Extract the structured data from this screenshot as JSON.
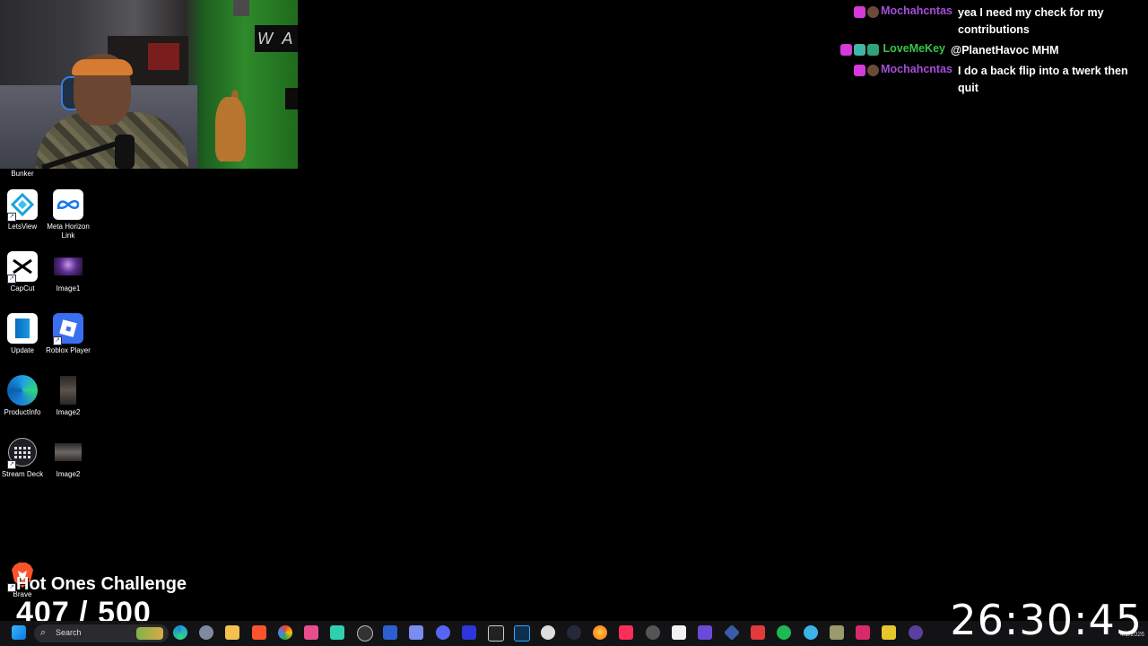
{
  "desktop": {
    "top_label": "Bunker",
    "icons": [
      {
        "label": "LetsView",
        "icon": "letsview-icon",
        "color": "#ffffff"
      },
      {
        "label": "Meta Horizon Link",
        "icon": "meta-icon",
        "color": "#ffffff"
      },
      {
        "label": "CapCut",
        "icon": "capcut-icon",
        "color": "#ffffff"
      },
      {
        "label": "Image1",
        "icon": "image-thumbnail-icon",
        "color": "#5b2d8f"
      },
      {
        "label": "Update",
        "icon": "update-icon",
        "color": "#ffffff"
      },
      {
        "label": "Roblox Player",
        "icon": "roblox-icon",
        "color": "#3b6ff2"
      },
      {
        "label": "ProductInfo",
        "icon": "edge-icon",
        "color": "#1b86d8"
      },
      {
        "label": "Image2",
        "icon": "image-thumbnail-icon",
        "color": "#3a3532"
      },
      {
        "label": "Stream Deck",
        "icon": "stream-deck-icon",
        "color": "#1e1e26"
      },
      {
        "label": "Image2",
        "icon": "image-thumbnail-icon",
        "color": "#4b4a48"
      },
      {
        "label": "Brave",
        "icon": "brave-icon",
        "color": "#fb542b"
      }
    ]
  },
  "chat": {
    "messages": [
      {
        "user": "Mochahcntas",
        "color": "#a64dd8",
        "text": "yea I need my check for my contributions",
        "badges": [
          "sub-badge-icon",
          "avatar-badge-icon"
        ]
      },
      {
        "user": "LoveMeKey",
        "color": "#35c64a",
        "text": "@PlanetHavoc MHM",
        "badges": [
          "sub-badge-icon",
          "gift-badge-icon",
          "gift-badge-icon"
        ]
      },
      {
        "user": "Mochahcntas",
        "color": "#a64dd8",
        "text": "I do a back flip into a twerk then quit",
        "badges": [
          "sub-badge-icon",
          "avatar-badge-icon"
        ]
      }
    ]
  },
  "overlay": {
    "challenge_title": "Hot Ones Challenge",
    "challenge_count": "407 / 500",
    "timer": "26:30:45"
  },
  "taskbar": {
    "search_label": "Search",
    "date": "4/2/2026",
    "apps": [
      "start-icon",
      "widgets-icon",
      "edge-icon",
      "settings-icon",
      "file-explorer-icon",
      "brave-icon",
      "chrome-icon",
      "app-icon",
      "app-icon",
      "obs-icon",
      "app-icon",
      "gamepad-icon",
      "discord-icon",
      "vegas-icon",
      "app-icon",
      "photoshop-icon",
      "app-icon",
      "app-icon",
      "firefox-icon",
      "itunes-icon",
      "app-icon",
      "app-icon",
      "app-icon",
      "app-icon",
      "app-icon",
      "spotify-icon",
      "app-icon",
      "app-icon",
      "app-icon",
      "app-icon",
      "app-icon"
    ]
  }
}
